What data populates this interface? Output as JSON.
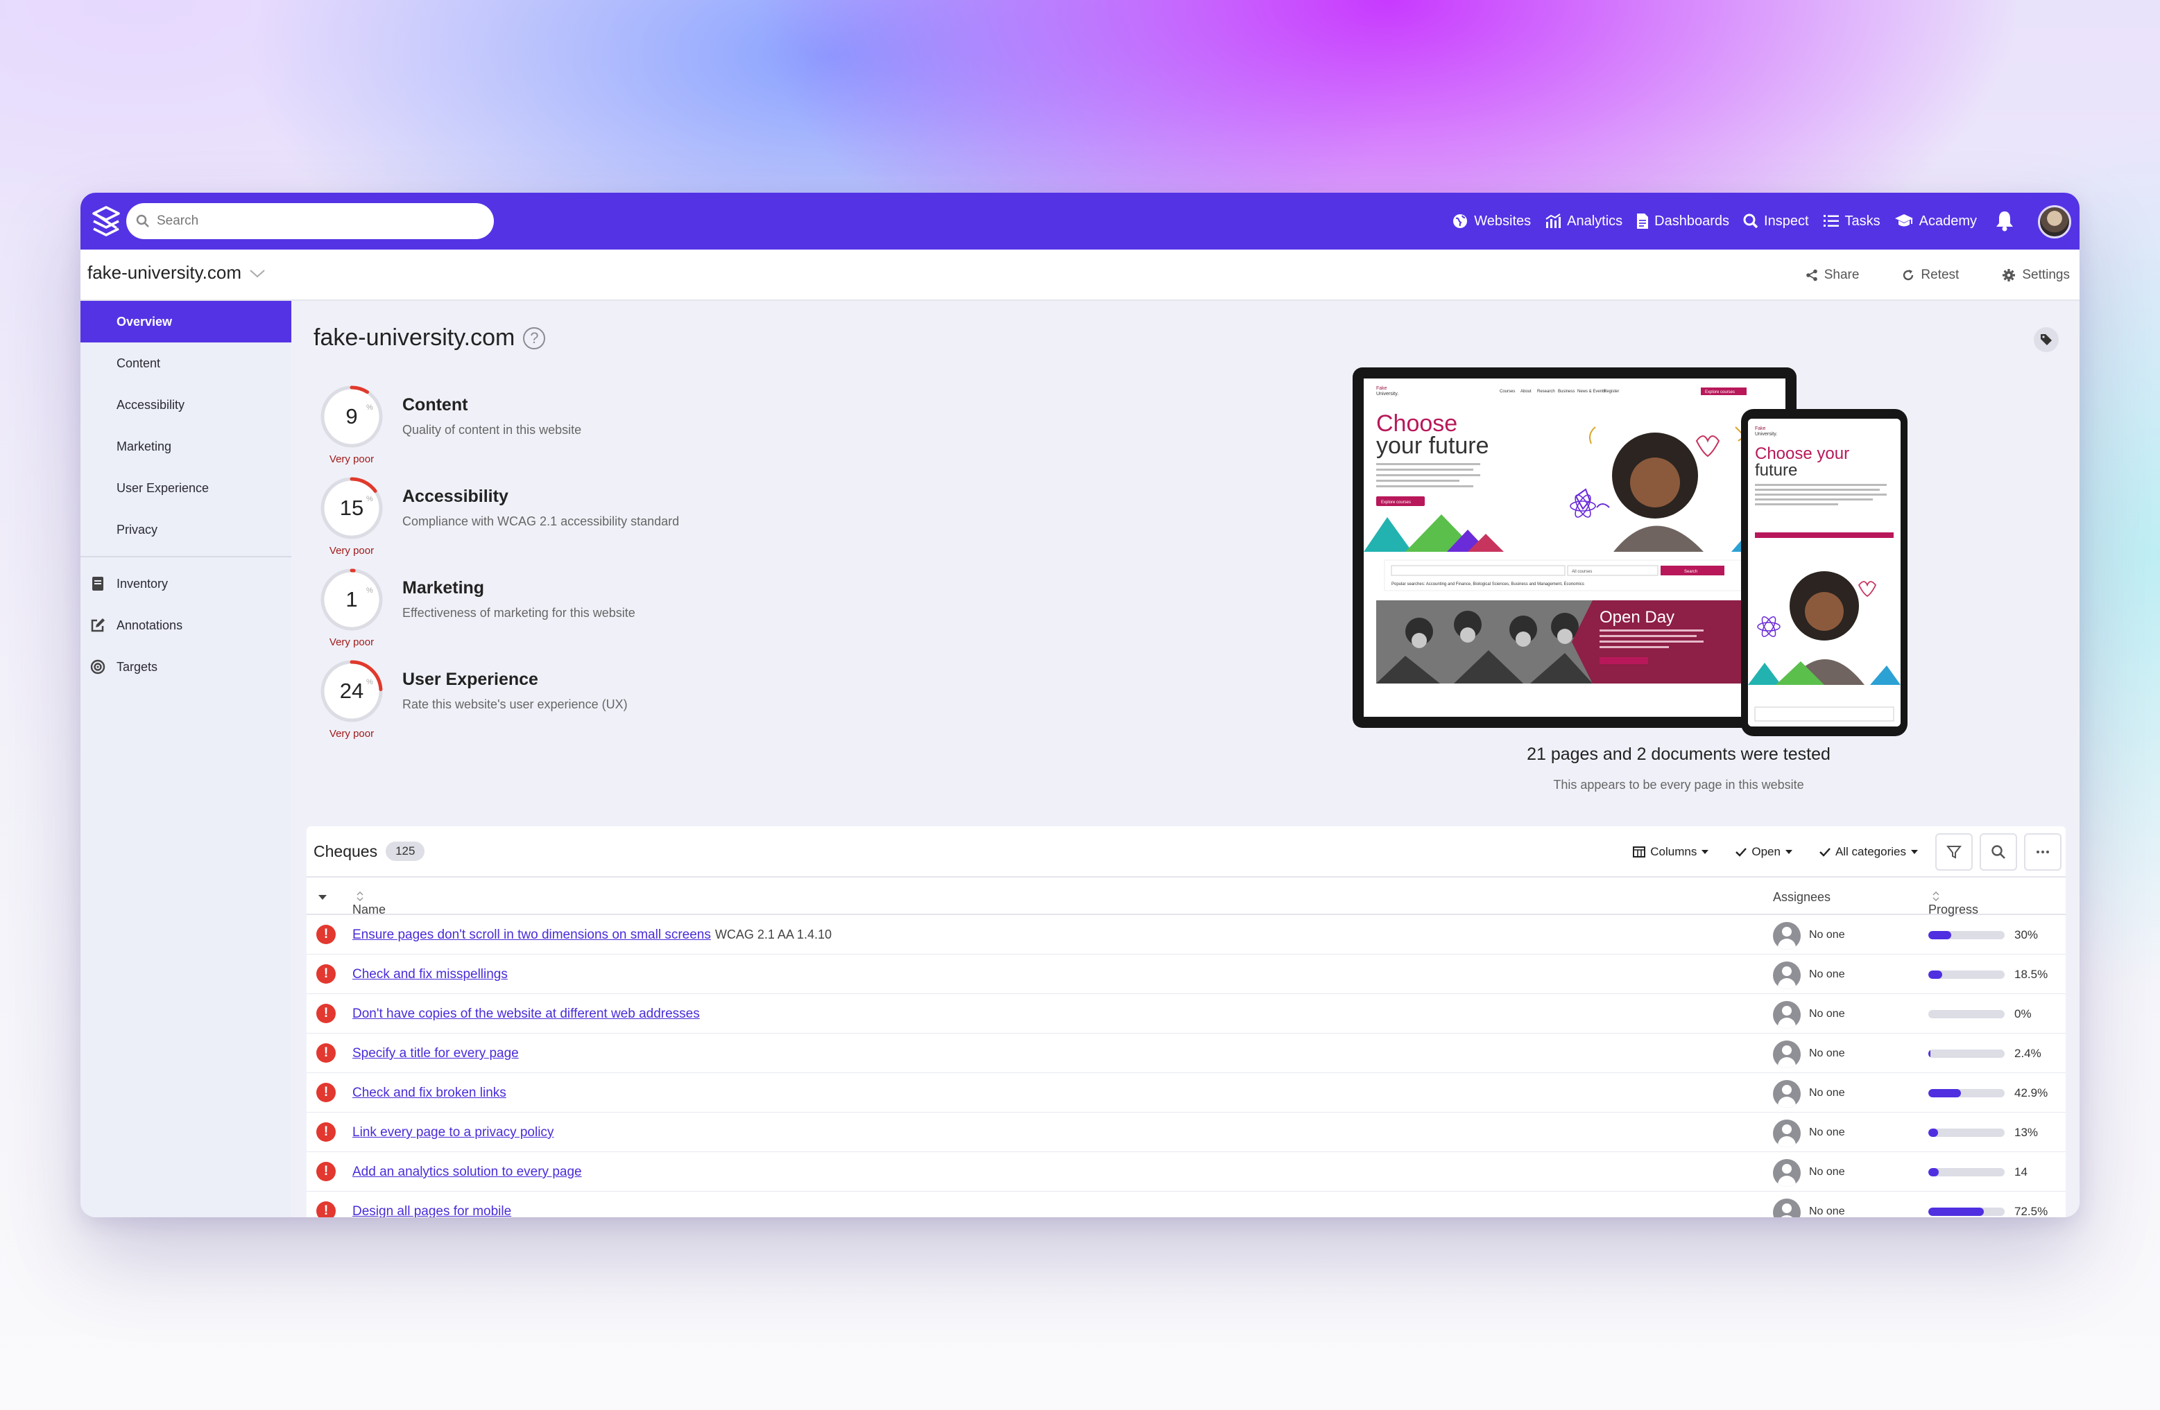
{
  "header": {
    "search_placeholder": "Search",
    "nav": [
      "Websites",
      "Analytics",
      "Dashboards",
      "Inspect",
      "Tasks",
      "Academy"
    ]
  },
  "subbar": {
    "site": "fake-university.com",
    "actions": [
      "Share",
      "Retest",
      "Settings"
    ]
  },
  "sidebar": {
    "items": [
      "Overview",
      "Content",
      "Accessibility",
      "Marketing",
      "User Experience",
      "Privacy"
    ],
    "tools": [
      "Inventory",
      "Annotations",
      "Targets"
    ]
  },
  "main": {
    "title": "fake-university.com",
    "help": "?",
    "scores": [
      {
        "value": "9",
        "unit": "%",
        "grade": "Very poor",
        "name": "Content",
        "desc": "Quality of content in this website",
        "fraction": 0.09
      },
      {
        "value": "15",
        "unit": "%",
        "grade": "Very poor",
        "name": "Accessibility",
        "desc": "Compliance with WCAG 2.1 accessibility standard",
        "fraction": 0.15
      },
      {
        "value": "1",
        "unit": "%",
        "grade": "Very poor",
        "name": "Marketing",
        "desc": "Effectiveness of marketing for this website",
        "fraction": 0.01
      },
      {
        "value": "24",
        "unit": "%",
        "grade": "Very poor",
        "name": "User Experience",
        "desc": "Rate this website's user experience (UX)",
        "fraction": 0.24
      }
    ],
    "preview": {
      "tablet_heading_1": "Choose",
      "tablet_heading_2": "your future",
      "tablet_button": "Explore courses",
      "tablet_search_select": "All courses",
      "tablet_search_button": "Search",
      "tablet_popular": "Popular searches: Accounting and Finance, Biological Sciences, Business and Management, Economics",
      "tablet_openday": "Open Day",
      "tablet_nav": [
        "Courses",
        "About",
        "Research",
        "Business",
        "News & Events",
        "Register"
      ],
      "tablet_nav_cta": "Explore courses",
      "logo_line1": "Fake",
      "logo_line2": "University.",
      "phone_heading_1": "Choose your",
      "phone_heading_2": "future"
    },
    "tested": "21 pages and 2 documents were tested",
    "tested_sub": "This appears to be every page in this website"
  },
  "cheques": {
    "title": "Cheques",
    "count": "125",
    "tools": [
      "Columns",
      "Open",
      "All categories"
    ],
    "columns": {
      "name": "Name",
      "assignees": "Assignees",
      "progress": "Progress"
    },
    "rows": [
      {
        "name": "Ensure pages don't scroll in two dimensions on small screens",
        "extra": "WCAG 2.1 AA 1.4.10",
        "assignee": "No one",
        "progress": "30%",
        "fraction": 0.3
      },
      {
        "name": "Check and fix misspellings",
        "extra": "",
        "assignee": "No one",
        "progress": "18.5%",
        "fraction": 0.185
      },
      {
        "name": "Don't have copies of the website at different web addresses",
        "extra": "",
        "assignee": "No one",
        "progress": "0%",
        "fraction": 0
      },
      {
        "name": "Specify a title for every page",
        "extra": "",
        "assignee": "No one",
        "progress": "2.4%",
        "fraction": 0.024
      },
      {
        "name": "Check and fix broken links",
        "extra": "",
        "assignee": "No one",
        "progress": "42.9%",
        "fraction": 0.429
      },
      {
        "name": "Link every page to a privacy policy",
        "extra": "",
        "assignee": "No one",
        "progress": "13%",
        "fraction": 0.13
      },
      {
        "name": "Add an analytics solution to every page",
        "extra": "",
        "assignee": "No one",
        "progress": "14",
        "fraction": 0.14
      },
      {
        "name": "Design all pages for mobile",
        "extra": "",
        "assignee": "No one",
        "progress": "72.5%",
        "fraction": 0.725
      }
    ]
  },
  "colors": {
    "accent": "#5433e5",
    "error": "#e2382f",
    "grade": "#a11a1a",
    "ring": "#e0392c"
  },
  "icons": [
    "logo-icon",
    "search-icon",
    "globe-icon",
    "analytics-icon",
    "document-icon",
    "inspect-icon",
    "list-icon",
    "graduation-cap-icon",
    "bell-icon",
    "share-icon",
    "retest-icon",
    "gear-icon",
    "chevron-down-icon",
    "inventory-icon",
    "annotations-icon",
    "targets-icon",
    "question-icon",
    "tag-icon",
    "columns-icon",
    "check-icon",
    "filter-icon",
    "more-icon",
    "sort-icon",
    "error-icon",
    "chat-icon"
  ]
}
